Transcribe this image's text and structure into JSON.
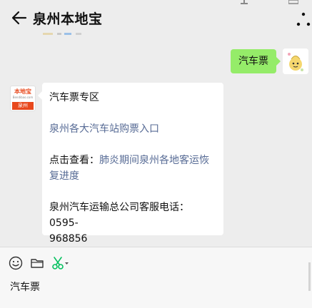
{
  "header": {
    "title": "泉州本地宝"
  },
  "chat": {
    "outgoing_message": "汽车票",
    "bot_avatar": {
      "brand": "本地宝",
      "sub": "Bendibao.com",
      "city": "泉州"
    },
    "incoming": {
      "heading": "汽车票专区",
      "link_purchase": "泉州各大汽车站购票入口",
      "check_prefix": "点击查看：",
      "check_link_line1": "肺炎期间泉州各地客运恢",
      "check_link_line2": "复进度",
      "phone_line1": "泉州汽车运输总公司客服电话：0595-",
      "phone_line2": "968856"
    }
  },
  "input": {
    "text": "汽车票"
  },
  "colors": {
    "background": "#ededed",
    "outgoing_bubble": "#95ec69",
    "link": "#576b95",
    "brand_orange": "#e8481c",
    "scissors_green": "#07c160"
  },
  "icons": {
    "back": "arrow-left",
    "more": "three-dots-vertical",
    "emoji": "smiley-face",
    "folder": "folder",
    "scissors": "scissors"
  }
}
